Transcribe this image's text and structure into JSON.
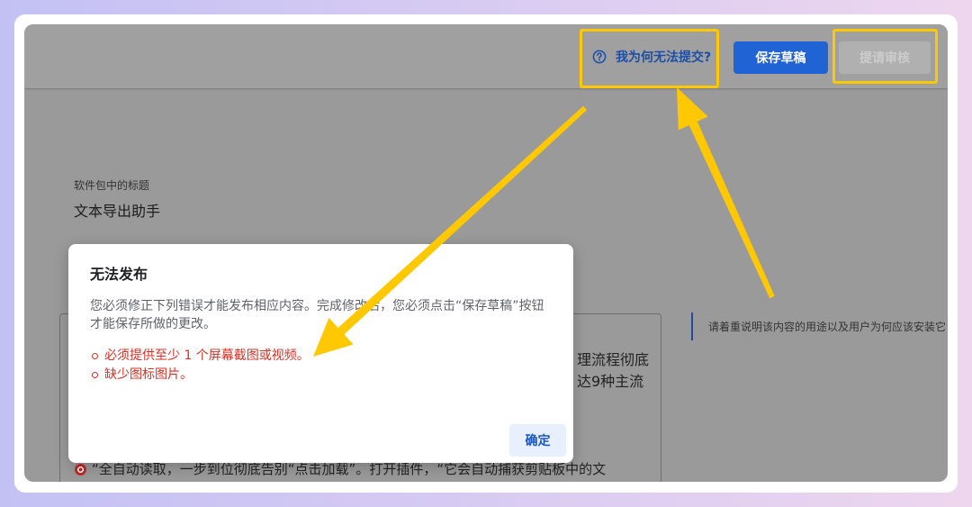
{
  "theme": {
    "primary": "#1f63d4",
    "error": "#d93025",
    "annotation": "#ffc800"
  },
  "icons": {
    "help": "help-circle-icon",
    "target": "target-emoji-icon",
    "bullet": "hollow-circle-bullet-icon"
  },
  "header": {
    "why_link": "我为何无法提交?",
    "save_draft": "保存草稿",
    "submit_review": "提请审核"
  },
  "form": {
    "title_label": "软件包中的标题",
    "title_value": "文本导出助手",
    "description_fragments": [
      "理流程彻底",
      "达9种主流"
    ],
    "description_last_line": "“全自动读取，一步到位彻底告别“点击加载”。打开插件，“它会自动捕获剪贴板中的文",
    "hint": "请着重说明该内容的用途以及用户为何应该安装它"
  },
  "dialog": {
    "title": "无法发布",
    "message_lines": [
      "您必须修正下列错误才能发布相应内容。完成修改后，您必须点击“保存草稿”按钮",
      "才能保存所做的更改。"
    ],
    "errors": [
      "必须提供至少 1 个屏幕截图或视频。",
      "缺少图标图片。"
    ],
    "confirm": "确定"
  }
}
